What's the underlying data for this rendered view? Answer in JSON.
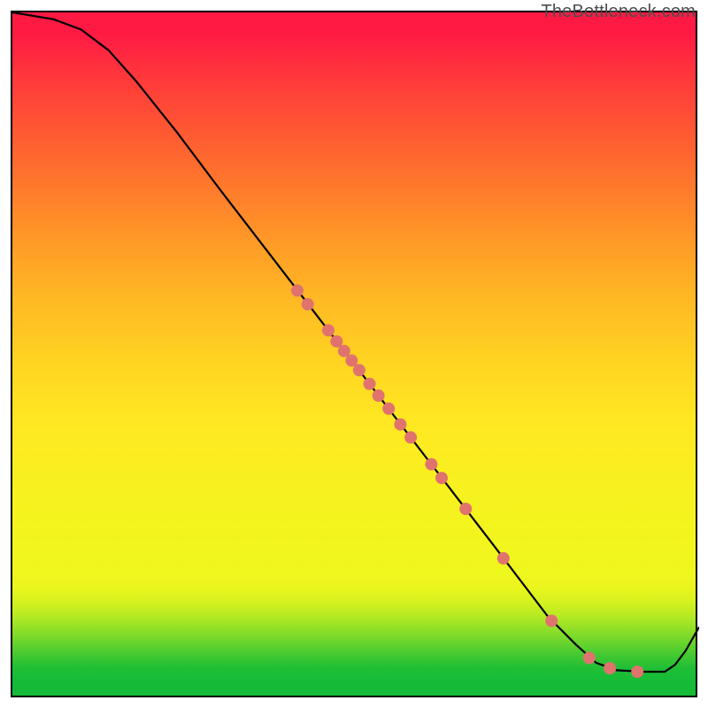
{
  "attribution": "TheBottleneck.com",
  "chart_data": {
    "type": "line",
    "title": "",
    "xlabel": "",
    "ylabel": "",
    "xlim": [
      0,
      100
    ],
    "ylim": [
      0,
      100
    ],
    "curve": [
      {
        "x": 0,
        "y": 100
      },
      {
        "x": 6,
        "y": 99
      },
      {
        "x": 10,
        "y": 97.5
      },
      {
        "x": 14,
        "y": 94.5
      },
      {
        "x": 18,
        "y": 90
      },
      {
        "x": 24,
        "y": 82.5
      },
      {
        "x": 30,
        "y": 74.5
      },
      {
        "x": 40,
        "y": 61.5
      },
      {
        "x": 50,
        "y": 48.5
      },
      {
        "x": 60,
        "y": 35.5
      },
      {
        "x": 70,
        "y": 22.5
      },
      {
        "x": 78,
        "y": 12
      },
      {
        "x": 82,
        "y": 8
      },
      {
        "x": 85,
        "y": 5.3
      },
      {
        "x": 88,
        "y": 4.2
      },
      {
        "x": 92,
        "y": 4
      },
      {
        "x": 95,
        "y": 4
      },
      {
        "x": 96.5,
        "y": 5
      },
      {
        "x": 98,
        "y": 7
      },
      {
        "x": 100,
        "y": 10.5
      }
    ],
    "markers": [
      {
        "x": 41.5,
        "y": 59.5
      },
      {
        "x": 43.0,
        "y": 57.5
      },
      {
        "x": 46.0,
        "y": 53.7
      },
      {
        "x": 47.2,
        "y": 52.1
      },
      {
        "x": 48.3,
        "y": 50.7
      },
      {
        "x": 49.4,
        "y": 49.3
      },
      {
        "x": 50.5,
        "y": 47.9
      },
      {
        "x": 52.0,
        "y": 45.9
      },
      {
        "x": 53.3,
        "y": 44.2
      },
      {
        "x": 54.8,
        "y": 42.3
      },
      {
        "x": 56.5,
        "y": 40.0
      },
      {
        "x": 58.0,
        "y": 38.1
      },
      {
        "x": 61.0,
        "y": 34.2
      },
      {
        "x": 62.5,
        "y": 32.2
      },
      {
        "x": 66.0,
        "y": 27.7
      },
      {
        "x": 71.5,
        "y": 20.5
      },
      {
        "x": 78.5,
        "y": 11.4
      },
      {
        "x": 84.0,
        "y": 6.0
      },
      {
        "x": 87.0,
        "y": 4.5
      },
      {
        "x": 91.0,
        "y": 4.0
      }
    ],
    "marker_color": "#e0736d",
    "marker_radius_px": 7
  }
}
